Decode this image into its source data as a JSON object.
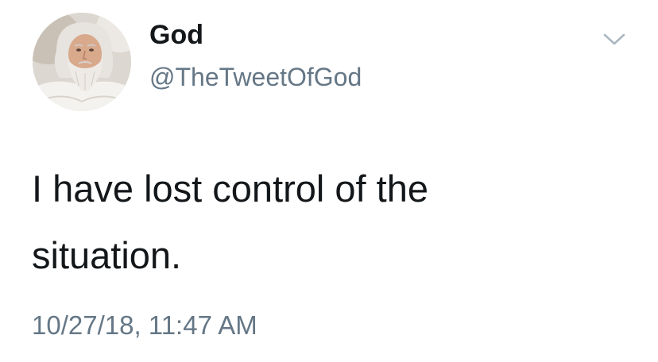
{
  "tweet": {
    "author": {
      "display_name": "God",
      "handle": "@TheTweetOfGod"
    },
    "text": "I have lost control of the\nsituation.",
    "timestamp": "10/27/18, 11:47 AM"
  },
  "icons": {
    "menu": "chevron-down-icon",
    "avatar": "avatar"
  },
  "colors": {
    "primary_text": "#14171a",
    "secondary_text": "#657786",
    "chevron": "#aab8c2",
    "background": "#ffffff"
  }
}
